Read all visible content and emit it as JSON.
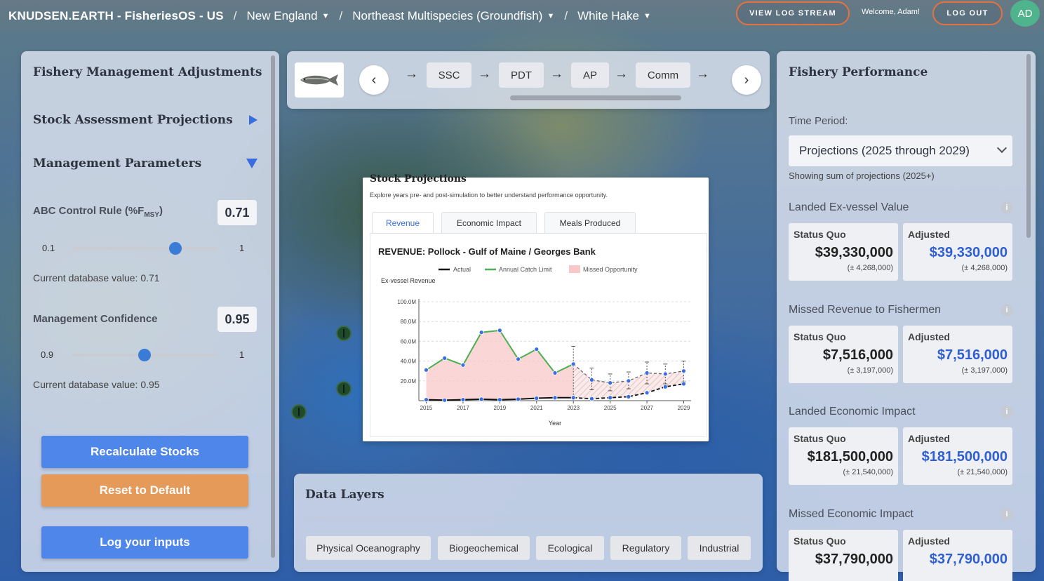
{
  "topbar": {
    "brand": "KNUDSEN.EARTH - FisheriesOS - US",
    "sep": "/",
    "breadcrumbs": [
      "New England",
      "Northeast Multispecies (Groundfish)",
      "White Hake"
    ],
    "caret": "▼",
    "view_log": "VIEW LOG STREAM",
    "welcome": "Welcome, Adam!",
    "logout": "LOG OUT",
    "avatar": "AD"
  },
  "left": {
    "title": "Fishery Management Adjustments",
    "section1": "Stock Assessment Projections",
    "section2": "Management Parameters",
    "abc": {
      "label": "ABC Control Rule (%F",
      "label_sub": "MSY",
      "label_end": ")",
      "value": "0.71",
      "min": "0.1",
      "max": "1",
      "level": 0.71,
      "db": "Current database value: 0.71"
    },
    "conf": {
      "label": "Management Confidence",
      "value": "0.95",
      "min": "0.9",
      "max": "1",
      "level": 0.5,
      "db": "Current database value: 0.95"
    },
    "btn_recalc": "Recalculate Stocks",
    "btn_reset": "Reset to Default",
    "btn_log": "Log your inputs"
  },
  "pipeline": {
    "prev": "‹",
    "next": "›",
    "arrow": "→",
    "steps": [
      "SSC",
      "PDT",
      "AP",
      "Comm"
    ]
  },
  "chart_card": {
    "title": "Stock Projections",
    "subtitle": "Explore years pre- and post-simulation to better understand performance opportunity.",
    "tabs": [
      "Revenue",
      "Economic Impact",
      "Meals Produced"
    ],
    "plot_title": "REVENUE: Pollock - Gulf of Maine / Georges Bank"
  },
  "chart_data": {
    "type": "line",
    "ylabel": "Ex-vessel Revenue",
    "xlabel": "Year",
    "ylim": [
      0,
      100
    ],
    "xlim": [
      2014.6,
      2029.4
    ],
    "y_ticks": [
      "100.0M",
      "80.0M",
      "60.0M",
      "40.0M",
      "20.0M"
    ],
    "y_tick_values": [
      100,
      80,
      60,
      40,
      20
    ],
    "x_ticks": [
      2015,
      2017,
      2019,
      2021,
      2023,
      2025,
      2027,
      2029
    ],
    "legend": [
      "Actual",
      "Annual Catch Limit",
      "Missed Opportunity"
    ],
    "grid": true,
    "colors": {
      "actual": "#111111",
      "acl": "#4caf50",
      "missed": "#f8c8c8",
      "proj": "#3a6de0"
    },
    "actual": {
      "x": [
        2015,
        2016,
        2017,
        2018,
        2019,
        2020,
        2021,
        2022,
        2023
      ],
      "y": [
        1,
        0.5,
        1,
        1.5,
        1,
        1.5,
        2.5,
        3,
        3
      ]
    },
    "acl": {
      "x": [
        2015,
        2016,
        2017,
        2018,
        2019,
        2020,
        2021,
        2022,
        2023
      ],
      "y": [
        31,
        43,
        36,
        69,
        71,
        42,
        52,
        28,
        37
      ]
    },
    "proj_acl": {
      "x": [
        2023,
        2024,
        2025,
        2026,
        2027,
        2028,
        2029
      ],
      "y": [
        37,
        21,
        18,
        20,
        28,
        27,
        30
      ]
    },
    "proj_actual": {
      "x": [
        2023,
        2024,
        2025,
        2026,
        2027,
        2028,
        2029
      ],
      "y": [
        3,
        2,
        3,
        4,
        8,
        14,
        17
      ]
    },
    "proj_err": {
      "x": [
        2023,
        2024,
        2025,
        2026,
        2027,
        2028,
        2029
      ],
      "lo": [
        3,
        11,
        10,
        12,
        17,
        17,
        19
      ],
      "hi": [
        55,
        33,
        27,
        29,
        39,
        37,
        40
      ]
    }
  },
  "layers": {
    "title": "Data Layers",
    "chips": [
      "Physical Oceanography",
      "Biogeochemical",
      "Ecological",
      "Regulatory",
      "Industrial"
    ]
  },
  "right": {
    "title": "Fishery Performance",
    "time_label": "Time Period:",
    "time_value": "Projections (2025 through 2029)",
    "showing": "Showing sum of projections (2025+)",
    "info": "i",
    "sq_label": "Status Quo",
    "adj_label": "Adjusted",
    "metrics": [
      {
        "title": "Landed Ex-vessel Value",
        "sq": "$39,330,000",
        "sq_pm": "(± 4,268,000)",
        "adj": "$39,330,000",
        "adj_pm": "(± 4,268,000)"
      },
      {
        "title": "Missed Revenue to Fishermen",
        "sq": "$7,516,000",
        "sq_pm": "(± 3,197,000)",
        "adj": "$7,516,000",
        "adj_pm": "(± 3,197,000)"
      },
      {
        "title": "Landed Economic Impact",
        "sq": "$181,500,000",
        "sq_pm": "(± 21,540,000)",
        "adj": "$181,500,000",
        "adj_pm": "(± 21,540,000)"
      },
      {
        "title": "Missed Economic Impact",
        "sq": "$37,790,000",
        "sq_pm": "",
        "adj": "$37,790,000",
        "adj_pm": ""
      }
    ]
  }
}
